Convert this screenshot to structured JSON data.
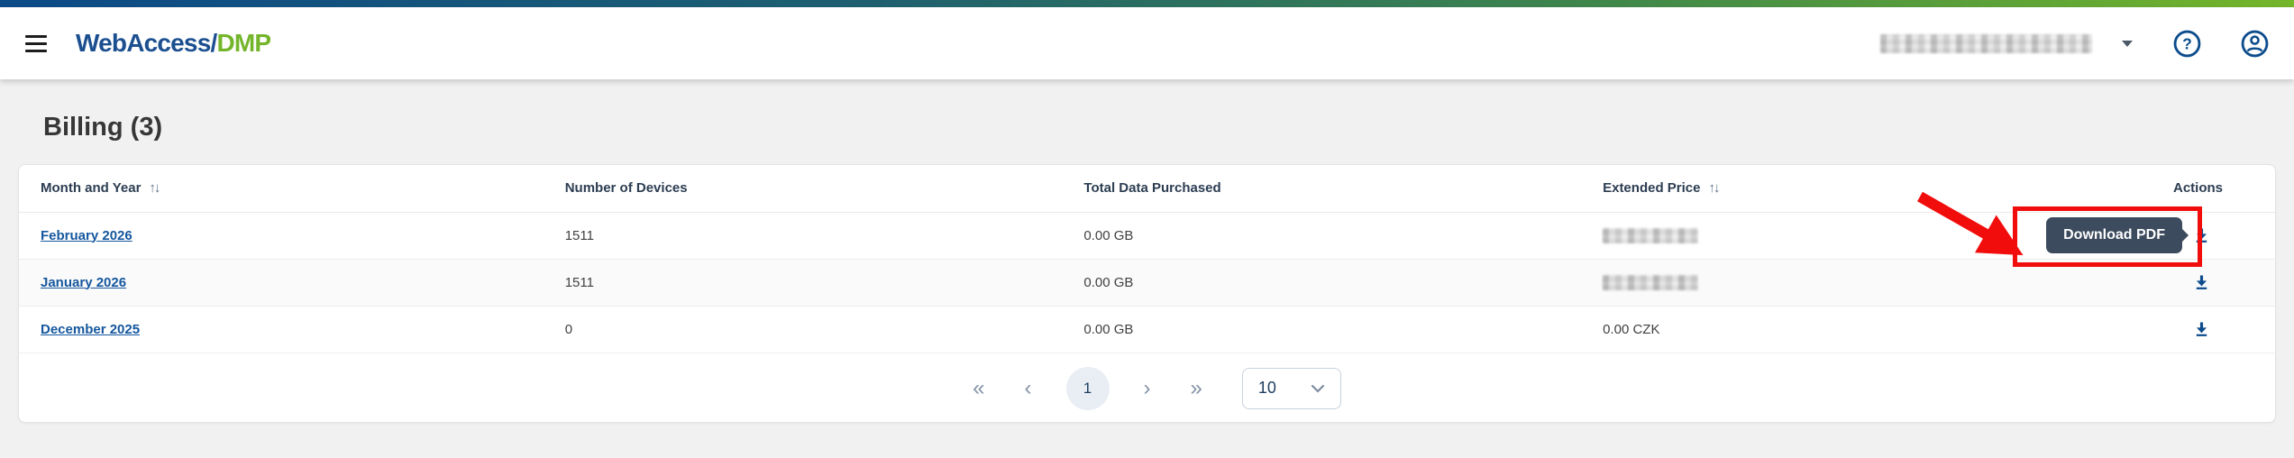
{
  "brand": {
    "primary": "WebAccess/",
    "secondary": "DMP"
  },
  "page": {
    "title": "Billing (3)"
  },
  "header": {
    "user_name_redacted": true,
    "icons": [
      "menu-icon",
      "caret-down-icon",
      "help-icon",
      "account-icon"
    ]
  },
  "table": {
    "columns": {
      "month": "Month and Year",
      "devices": "Number of Devices",
      "data": "Total Data Purchased",
      "price": "Extended Price",
      "actions": "Actions"
    },
    "sort": {
      "up": "↑",
      "down": "↓"
    },
    "rows": [
      {
        "month": "February 2026",
        "devices": "1511",
        "data": "0.00 GB",
        "price": "",
        "price_redacted": true
      },
      {
        "month": "January 2026",
        "devices": "1511",
        "data": "0.00 GB",
        "price": "",
        "price_redacted": true
      },
      {
        "month": "December 2025",
        "devices": "0",
        "data": "0.00 GB",
        "price": "0.00 CZK",
        "price_redacted": false
      }
    ]
  },
  "tooltip": {
    "label": "Download PDF"
  },
  "pagination": {
    "first": "«",
    "prev": "‹",
    "page": "1",
    "next": "›",
    "last": "»",
    "page_size": "10"
  },
  "colors": {
    "brand_blue": "#1b4f90",
    "brand_green": "#74b52b",
    "link_blue": "#15579e",
    "icon_navy": "#0d4c8c",
    "tooltip_bg": "#3c4b5d",
    "annotation_red": "#f20d0d"
  }
}
